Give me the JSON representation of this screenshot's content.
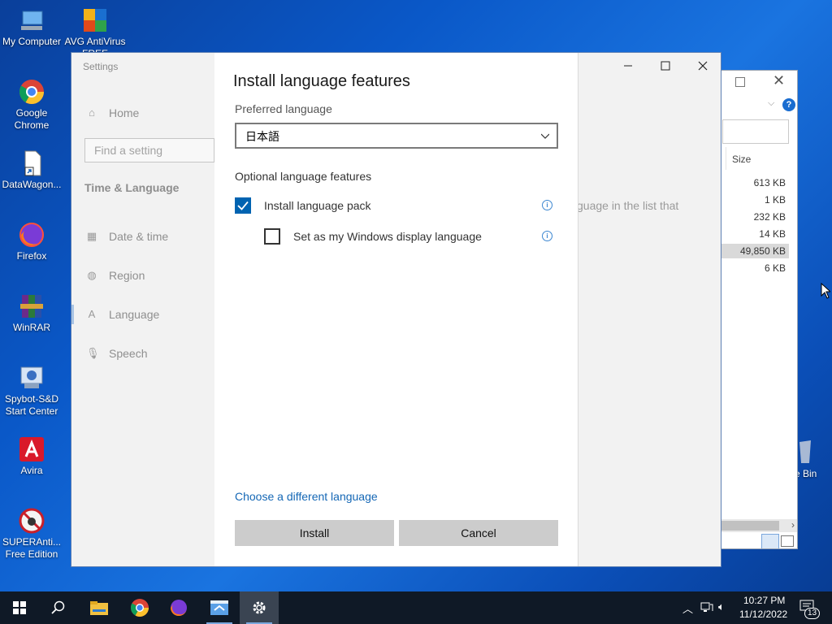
{
  "desktop": {
    "icons": [
      {
        "label": "My Computer",
        "name": "my-computer"
      },
      {
        "label": "AVG AntiVirus FREE",
        "name": "avg-antivirus"
      },
      {
        "label": "Google Chrome",
        "name": "google-chrome"
      },
      {
        "label": "DataWagon...",
        "name": "datawagon"
      },
      {
        "label": "Firefox",
        "name": "firefox"
      },
      {
        "label": "WinRAR",
        "name": "winrar"
      },
      {
        "label": "Spybot-S&D Start Center",
        "name": "spybot"
      },
      {
        "label": "Avira",
        "name": "avira"
      },
      {
        "label": "SUPERAnti... Free Edition",
        "name": "superantispyware"
      },
      {
        "label": "e Bin",
        "name": "recycle-bin"
      }
    ]
  },
  "explorer": {
    "size_header": "Size",
    "rows": [
      "613 KB",
      "1 KB",
      "232 KB",
      "14 KB",
      "49,850 KB",
      "6 KB"
    ]
  },
  "settings": {
    "title": "Settings",
    "home": "Home",
    "search_placeholder": "Find a setting",
    "section": "Time & Language",
    "nav": [
      "Date & time",
      "Region",
      "Language",
      "Speech"
    ],
    "background_text": "guage in the list that"
  },
  "dialog": {
    "title": "Install language features",
    "preferred_label": "Preferred language",
    "preferred_value": "日本語",
    "optional_label": "Optional language features",
    "option1": "Install language pack",
    "option1_checked": true,
    "option2": "Set as my Windows display language",
    "option2_checked": false,
    "link": "Choose a different language",
    "install": "Install",
    "cancel": "Cancel"
  },
  "taskbar": {
    "time": "10:27 PM",
    "date": "11/12/2022",
    "notifications": "13"
  }
}
